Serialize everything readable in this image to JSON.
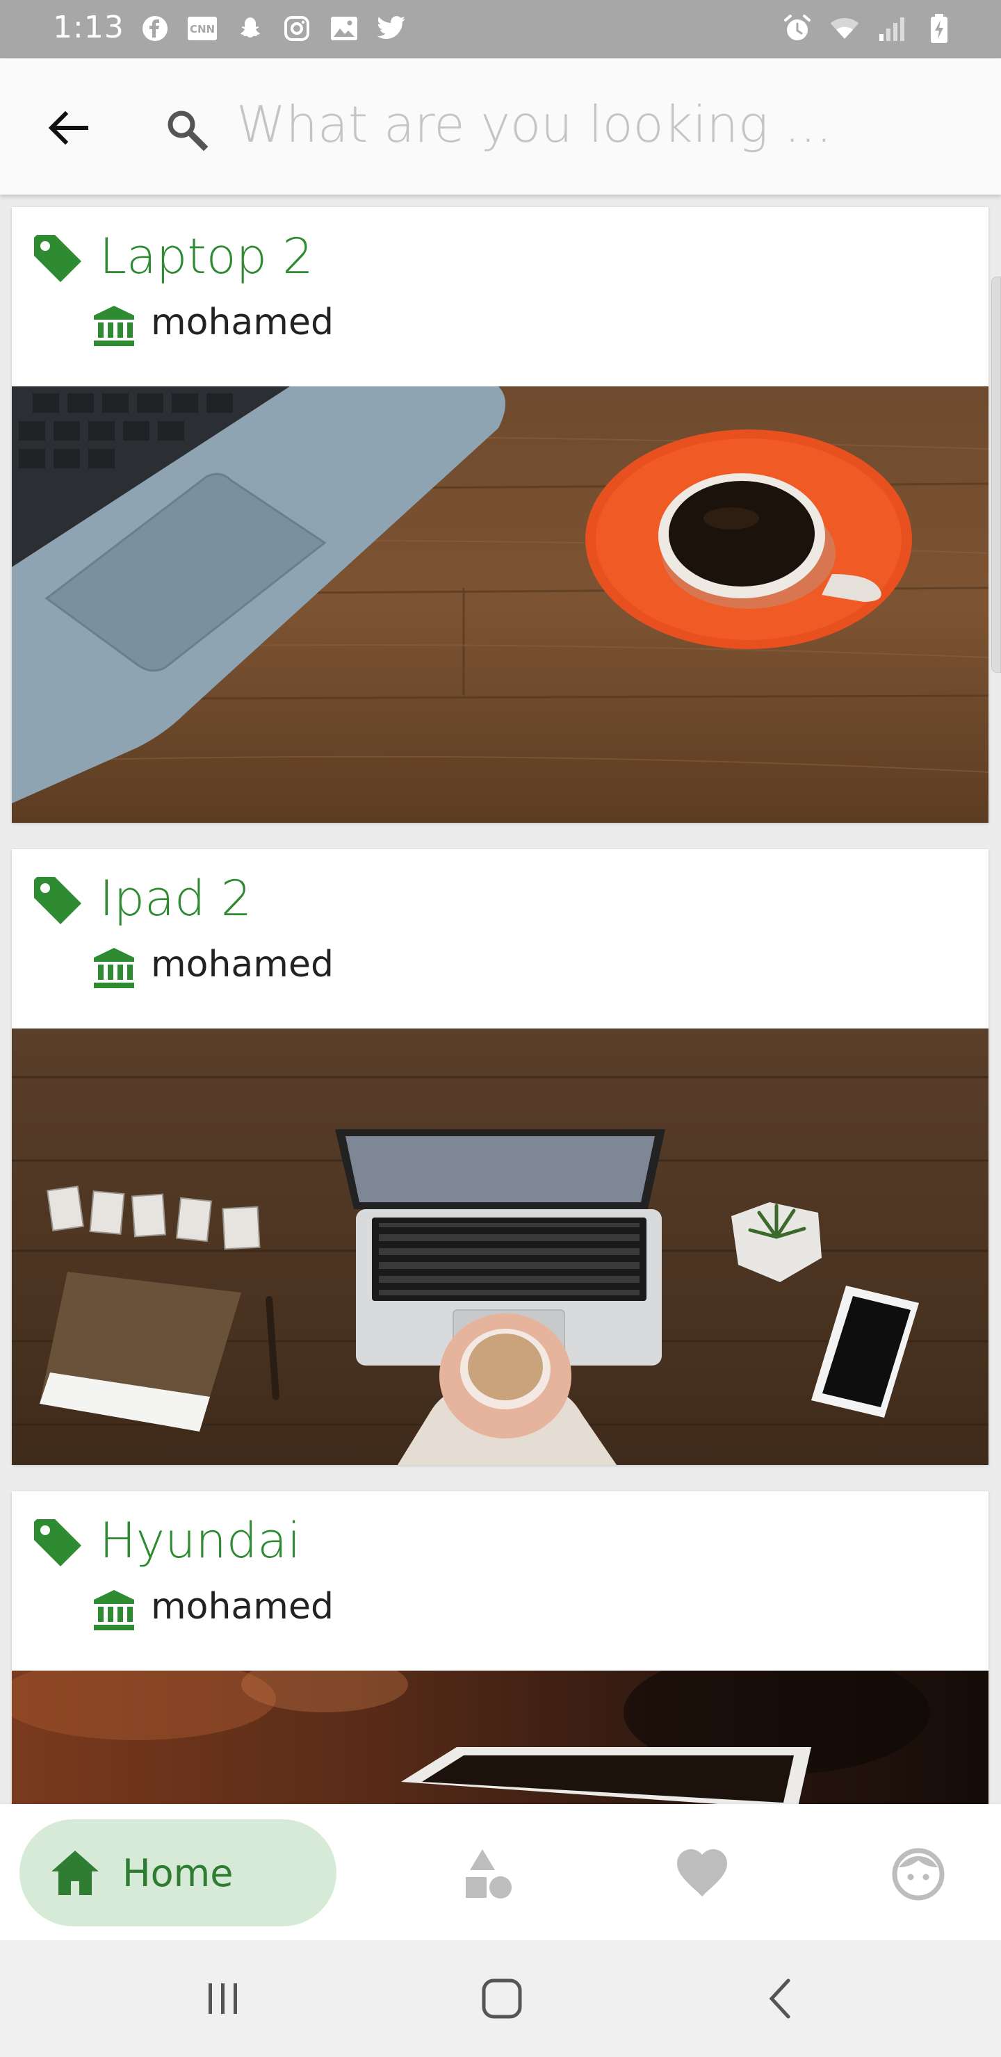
{
  "status_bar": {
    "time": "1:13",
    "left_icons": [
      "facebook-icon",
      "cnn-icon",
      "snapchat-icon",
      "instagram-icon",
      "gallery-icon",
      "twitter-icon"
    ],
    "right_icons": [
      "alarm-icon",
      "wifi-icon",
      "signal-icon",
      "battery-charging-icon"
    ]
  },
  "header": {
    "search_placeholder": "What are you looking ...",
    "search_value": ""
  },
  "colors": {
    "accent": "#2e8b32",
    "nav_active_bg": "#d7ead8",
    "status_bar": "#a7a7a7"
  },
  "cards": [
    {
      "title": "Laptop 2",
      "owner": "mohamed",
      "image": "laptop-and-coffee-photo"
    },
    {
      "title": "Ipad 2",
      "owner": "mohamed",
      "image": "desk-laptop-dream-photo"
    },
    {
      "title": "Hyundai",
      "owner": "mohamed",
      "image": "blurred-laptop-photo"
    }
  ],
  "bottom_nav": {
    "home_label": "Home",
    "items": [
      "home-icon",
      "categories-icon",
      "favorites-icon",
      "profile-icon"
    ]
  },
  "system_nav": [
    "recent-apps-icon",
    "home-button-icon",
    "back-button-icon"
  ]
}
